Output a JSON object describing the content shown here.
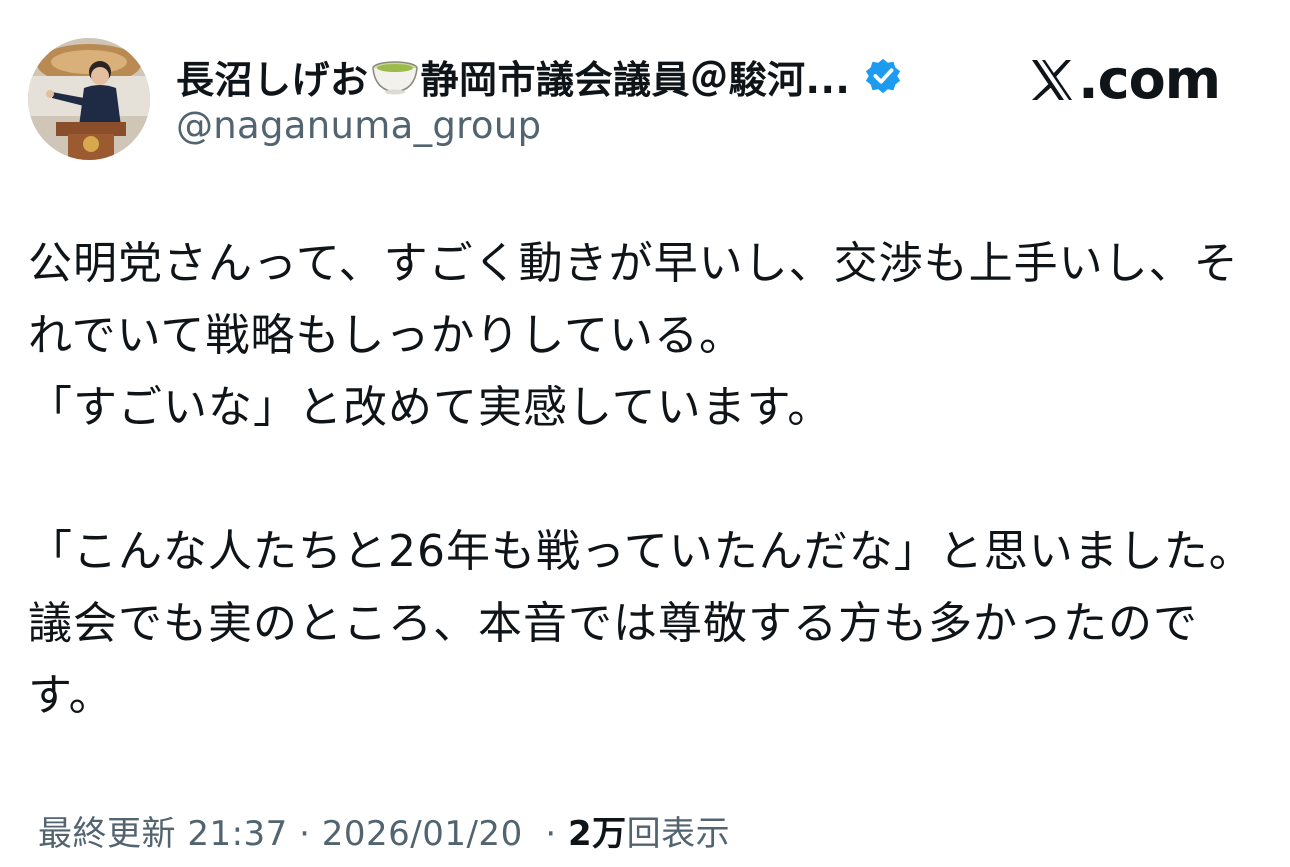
{
  "author": {
    "display_name_part1": "長沼しげお",
    "display_name_part2": "静岡市議会議員＠駿河...",
    "handle": "@naganuma_group",
    "emoji_icon": "green-tea-icon",
    "verified": true,
    "verified_color": "#1d9bf0"
  },
  "site": {
    "label": ".com",
    "logo_icon": "x-logo-icon"
  },
  "post": {
    "lines": [
      "公明党さんって、すごく動きが早いし、交渉も上手いし、そ",
      "れでいて戦略もしっかりしている。",
      "「すごいな」と改めて実感しています。",
      "",
      "「こんな人たちと26年も戦っていたんだな」と思いました。",
      "議会でも実のところ、本音では尊敬する方も多かったので",
      "す。"
    ]
  },
  "meta": {
    "updated_label": "最終更新",
    "time": "21:37",
    "separator": "·",
    "date": "2026/01/20",
    "views_number": "2万",
    "views_label": "回表示"
  },
  "colors": {
    "text": "#0f1419",
    "secondary": "#536471",
    "background": "#ffffff"
  }
}
